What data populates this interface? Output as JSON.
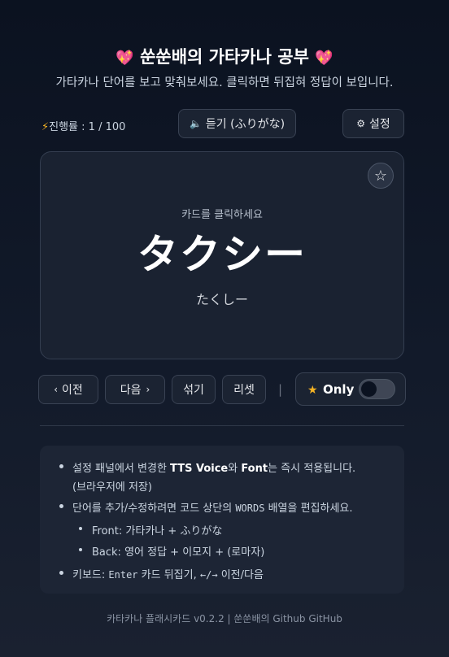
{
  "header": {
    "title": "쑨쑨배의 가타카나 공부",
    "title_icon": "sparkling-heart",
    "subtitle": "가타카나 단어를 보고 맞춰보세요. 클릭하면 뒤집혀 정답이 보입니다."
  },
  "toolbar": {
    "progress_label": "진행률 : 1 / 100",
    "listen_label": "듣기 (ふりがな)",
    "settings_label": "설정"
  },
  "card": {
    "hint": "카드를 클릭하세요",
    "word": "タクシー",
    "reading": "たくしー",
    "favorite_icon": "star-outline"
  },
  "controls": {
    "prev_label": "이전",
    "next_label": "다음",
    "shuffle_label": "섞기",
    "reset_label": "리셋",
    "separator": "|",
    "only_label": "Only",
    "only_toggle_on": false
  },
  "info": {
    "item1_a": "설정 패널에서 변경한 ",
    "item1_b": "TTS Voice",
    "item1_c": "와 ",
    "item1_d": "Font",
    "item1_e": "는 즉시 적용됩니다.",
    "item1_f": "(브라우저에 저장)",
    "item2_a": "단어를 추가/수정하려면 코드 상단의 ",
    "item2_b": "WORDS",
    "item2_c": " 배열을 편집하세요.",
    "sub1": "Front: 가타카나 + ふりがな",
    "sub2": "Back: 영어 정답 + 이모지 + (로마자)",
    "item3_a": "키보드: ",
    "item3_b": "Enter",
    "item3_c": " 카드 뒤집기, ",
    "item3_d": "←/→",
    "item3_e": " 이전/다음"
  },
  "footer": {
    "text": "카타카나 플래시카드 v0.2.2 | 쑨쑨배의 Github GitHub"
  },
  "colors": {
    "background": "#0b1220",
    "card": "#1a2231",
    "accent_star": "#f5b324",
    "heart": "#f43f8e"
  }
}
